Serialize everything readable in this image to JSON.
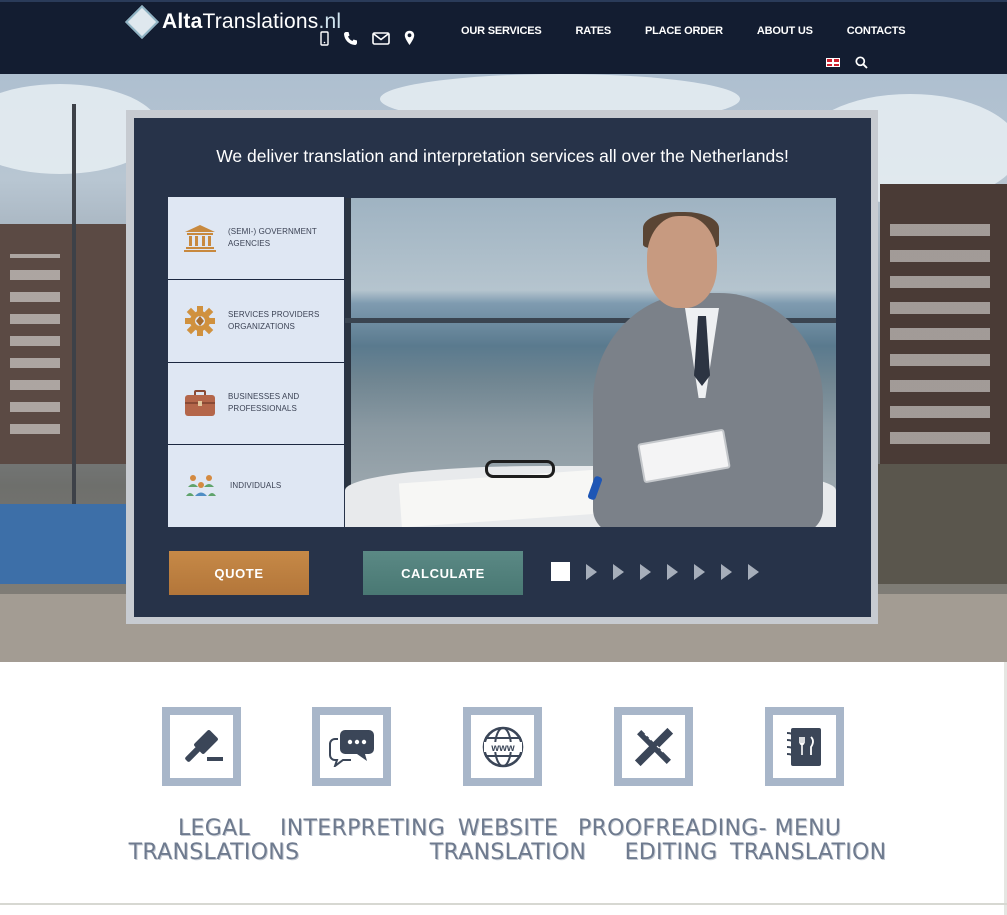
{
  "header": {
    "logo": {
      "bold": "Alta",
      "rest": "Translations",
      "tld": ".nl"
    },
    "contact_icons": [
      "mobile-icon",
      "phone-icon",
      "mail-icon",
      "location-icon"
    ],
    "nav": [
      "OUR SERVICES",
      "RATES",
      "PLACE ORDER",
      "ABOUT US",
      "CONTACTS"
    ],
    "language_flag": "uk-flag-icon",
    "search_icon": "search-icon"
  },
  "hero": {
    "title": "We deliver translation and interpretation services all over the Netherlands!",
    "categories": [
      {
        "icon": "government-building-icon",
        "label": "(SEMI-) GOVERNMENT AGENCIES"
      },
      {
        "icon": "gear-icon",
        "label": "SERVICES PROVIDERS ORGANIZATIONS"
      },
      {
        "icon": "briefcase-icon",
        "label": "BUSINESSES AND PROFESSIONALS"
      },
      {
        "icon": "people-group-icon",
        "label": "INDIVIDUALS"
      }
    ],
    "quote_button": "QUOTE",
    "calculate_button": "CALCULATE",
    "slider": {
      "active_index": 0,
      "count": 8
    }
  },
  "services": [
    {
      "icon": "gavel-icon",
      "label": "LEGAL TRANSLATIONS"
    },
    {
      "icon": "speech-bubbles-icon",
      "label": "INTERPRETING"
    },
    {
      "icon": "www-globe-icon",
      "label": "WEBSITE TRANSLATION"
    },
    {
      "icon": "pencil-ruler-icon",
      "label": "PROOFREADING-EDITING"
    },
    {
      "icon": "menu-book-icon",
      "label": "MENU TRANSLATION"
    }
  ],
  "colors": {
    "header_bg": "#131d31",
    "panel_bg": "#1b273e",
    "quote": "#c68947",
    "calculate": "#5b8985",
    "service_icon_frame": "#a8b6c9",
    "service_text": "#6e7a8e"
  }
}
